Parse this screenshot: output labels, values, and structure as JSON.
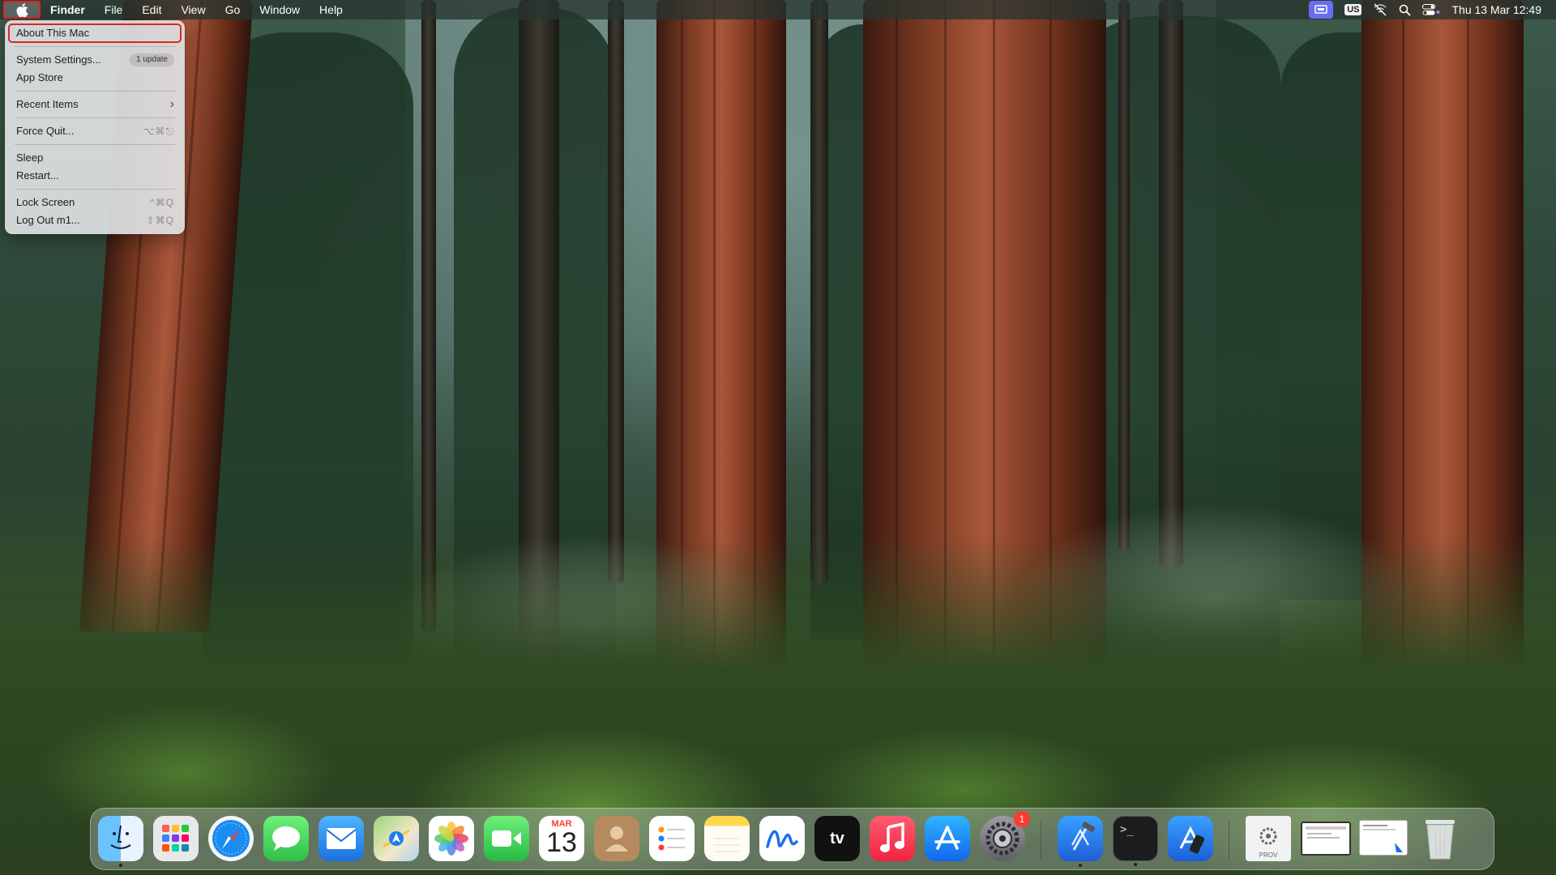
{
  "menubar": {
    "apple_icon": "apple-icon",
    "app_name": "Finder",
    "menus": [
      "File",
      "Edit",
      "View",
      "Go",
      "Window",
      "Help"
    ],
    "status_icons": [
      "screen-share-icon",
      "keyboard-layout-icon",
      "wifi-off-icon",
      "spotlight-search-icon",
      "control-center-icon"
    ],
    "input_source": "US",
    "clock": "Thu 13 Mar  12:49"
  },
  "apple_menu": {
    "items": [
      {
        "label": "About This Mac",
        "highlighted": true
      },
      {
        "label": "System Settings...",
        "badge": "1 update"
      },
      {
        "label": "App Store"
      },
      {
        "label": "Recent Items",
        "submenu": true
      },
      {
        "label": "Force Quit...",
        "shortcut": "⌥⌘⎋"
      },
      {
        "label": "Sleep"
      },
      {
        "label": "Restart..."
      },
      {
        "label": "Lock Screen",
        "shortcut": "^⌘Q"
      },
      {
        "label": "Log Out m1...",
        "shortcut": "⇧⌘Q"
      }
    ]
  },
  "dock": {
    "apps": [
      {
        "name": "Finder",
        "icon": "finder-icon",
        "running": true
      },
      {
        "name": "Launchpad",
        "icon": "launchpad-icon"
      },
      {
        "name": "Safari",
        "icon": "safari-icon"
      },
      {
        "name": "Messages",
        "icon": "messages-icon"
      },
      {
        "name": "Mail",
        "icon": "mail-icon"
      },
      {
        "name": "Maps",
        "icon": "maps-icon"
      },
      {
        "name": "Photos",
        "icon": "photos-icon"
      },
      {
        "name": "FaceTime",
        "icon": "facetime-icon"
      },
      {
        "name": "Calendar",
        "icon": "calendar-icon",
        "month": "MAR",
        "day": "13"
      },
      {
        "name": "Contacts",
        "icon": "contacts-icon"
      },
      {
        "name": "Reminders",
        "icon": "reminders-icon"
      },
      {
        "name": "Notes",
        "icon": "notes-icon"
      },
      {
        "name": "Freeform",
        "icon": "freeform-icon"
      },
      {
        "name": "TV",
        "icon": "apple-tv-icon",
        "label": "tv"
      },
      {
        "name": "Music",
        "icon": "music-icon"
      },
      {
        "name": "App Store",
        "icon": "app-store-icon"
      },
      {
        "name": "System Settings",
        "icon": "system-settings-icon",
        "badge": "1"
      },
      {
        "name": "Xcode",
        "icon": "xcode-icon",
        "running": true
      },
      {
        "name": "Terminal",
        "icon": "terminal-icon",
        "running": true,
        "label": ">_"
      },
      {
        "name": "Simulator",
        "icon": "simulator-icon"
      },
      {
        "name": "Provisioning Profile",
        "icon": "provisioning-profile-icon",
        "label": "PROV"
      },
      {
        "name": "Window Preview 1",
        "icon": "window-preview-icon"
      },
      {
        "name": "Window Preview 2",
        "icon": "document-preview-icon"
      },
      {
        "name": "Trash",
        "icon": "trash-icon"
      }
    ]
  },
  "colors": {
    "highlight_outline": "#e02424",
    "menubar_bg": "#28342f",
    "notification_red": "#ff3b30"
  }
}
